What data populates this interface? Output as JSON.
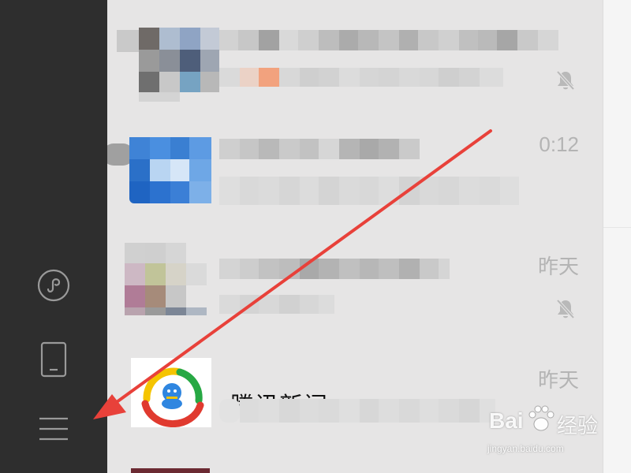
{
  "sidebar": {
    "icons": [
      "mini-program-icon",
      "phone-icon",
      "menu-icon"
    ]
  },
  "chats": [
    {
      "time": "",
      "muted": true
    },
    {
      "time": "0:12",
      "muted": false
    },
    {
      "time": "昨天",
      "muted": true
    },
    {
      "name": "腾讯新闻",
      "time": "昨天",
      "muted": false
    }
  ],
  "watermark": {
    "brand": "Bai",
    "brand2": "经验",
    "url": "jingyan.baidu.com"
  },
  "colors": {
    "sidebar": "#2e2e2e",
    "list_background": "#e6e5e5",
    "annotation_arrow": "#e8413a",
    "time_text": "#b4b4b4"
  }
}
